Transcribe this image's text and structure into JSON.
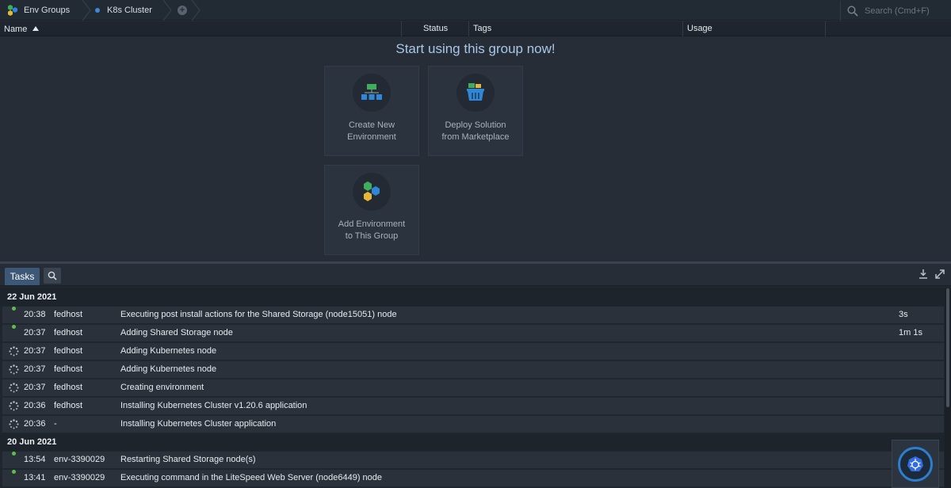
{
  "topbar": {
    "groups_label": "Env Groups",
    "cluster_label": "K8s Cluster",
    "add_label": "+",
    "search_placeholder": "Search (Cmd+F)"
  },
  "columns": {
    "name": "Name",
    "status": "Status",
    "tags": "Tags",
    "usage": "Usage"
  },
  "main": {
    "title": "Start using this group now!",
    "cards": [
      {
        "line1": "Create New",
        "line2": "Environment",
        "icon": "create-environment-icon"
      },
      {
        "line1": "Deploy Solution",
        "line2": "from Marketplace",
        "icon": "marketplace-basket-icon"
      },
      {
        "line1": "Add Environment",
        "line2": "to This Group",
        "icon": "env-group-hexagons-icon"
      }
    ]
  },
  "tasks": {
    "tab_label": "Tasks",
    "groups": [
      {
        "date": "22 Jun 2021",
        "rows": [
          {
            "status": "done",
            "time": "20:38",
            "user": "fedhost",
            "desc": "Executing post install actions for the Shared Storage (node15051) node",
            "dur": "3s"
          },
          {
            "status": "done",
            "time": "20:37",
            "user": "fedhost",
            "desc": "Adding Shared Storage node",
            "dur": "1m 1s"
          },
          {
            "status": "running",
            "time": "20:37",
            "user": "fedhost",
            "desc": "Adding Kubernetes node",
            "dur": ""
          },
          {
            "status": "running",
            "time": "20:37",
            "user": "fedhost",
            "desc": "Adding Kubernetes node",
            "dur": ""
          },
          {
            "status": "running",
            "time": "20:37",
            "user": "fedhost",
            "desc": "Creating environment",
            "dur": ""
          },
          {
            "status": "running",
            "time": "20:36",
            "user": "fedhost",
            "desc": "Installing Kubernetes Cluster v1.20.6 application",
            "dur": ""
          },
          {
            "status": "running",
            "time": "20:36",
            "user": "-",
            "desc": "Installing Kubernetes Cluster application",
            "dur": ""
          }
        ]
      },
      {
        "date": "20 Jun 2021",
        "rows": [
          {
            "status": "done",
            "time": "13:54",
            "user": "env-3390029",
            "desc": "Restarting Shared Storage node(s)",
            "dur": ""
          },
          {
            "status": "done",
            "time": "13:41",
            "user": "env-3390029",
            "desc": "Executing command in the LiteSpeed Web Server (node6449) node",
            "dur": ""
          }
        ]
      }
    ]
  },
  "colors": {
    "accent": "#3c5876",
    "success": "#5fbf4e",
    "k8s": "#2c7fd0"
  }
}
